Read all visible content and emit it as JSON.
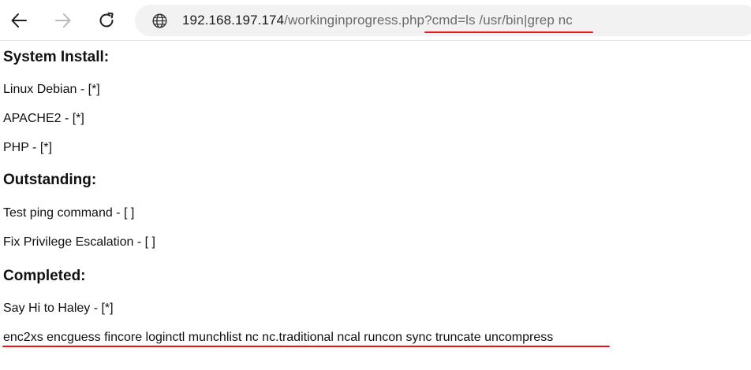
{
  "browser": {
    "url_host": "192.168.197.174",
    "url_path": "/workinginprogress.php",
    "url_query": "?cmd=ls /usr/bin|grep nc",
    "icons": {
      "back": "arrow-left-icon",
      "forward": "arrow-right-icon",
      "reload": "reload-icon",
      "site_info": "globe-icon"
    }
  },
  "page": {
    "sections": [
      {
        "heading": "System Install:",
        "items": [
          "Linux Debian - [*]",
          "APACHE2 - [*]",
          "PHP - [*]"
        ]
      },
      {
        "heading": "Outstanding:",
        "items": [
          "Test ping command - [ ]",
          "Fix Privilege Escalation - [ ]"
        ]
      },
      {
        "heading": "Completed:",
        "items": [
          "Say Hi to Haley - [*]"
        ]
      }
    ],
    "command_output": "enc2xs encguess fincore loginctl munchlist nc nc.traditional ncal runcon sync truncate uncompress"
  },
  "colors": {
    "annotation_underline": "#e8141a",
    "omnibox_bg": "#f2f2f2"
  }
}
